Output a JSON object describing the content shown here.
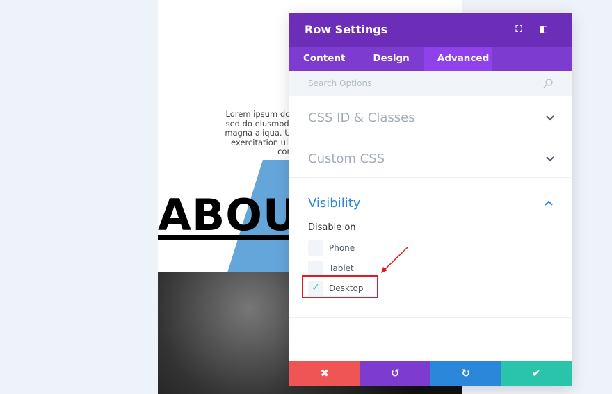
{
  "background_page": {
    "lorem_lines": [
      "Lorem ipsum dolor sit",
      "sed do eiusmod temp",
      "magna aliqua. Ut enin",
      "exercitation ullamc",
      "comm"
    ],
    "heading": "ABOU"
  },
  "panel": {
    "title": "Row Settings",
    "header_icons": [
      "fullscreen-icon",
      "sidebar-layout-icon"
    ],
    "tabs": [
      {
        "label": "Content"
      },
      {
        "label": "Design"
      },
      {
        "label": "Advanced",
        "active": true
      }
    ],
    "search_placeholder": "Search Options",
    "sections": [
      {
        "label": "CSS ID & Classes",
        "expanded": false
      },
      {
        "label": "Custom CSS",
        "expanded": false
      },
      {
        "label": "Visibility",
        "expanded": true
      }
    ],
    "visibility": {
      "label": "Disable on",
      "options": [
        {
          "label": "Phone",
          "checked": false
        },
        {
          "label": "Tablet",
          "checked": false
        },
        {
          "label": "Desktop",
          "checked": true
        }
      ]
    },
    "footer": {
      "colors": {
        "cancel": "#ef5555",
        "undo": "#7e3bd0",
        "redo": "#2b87da",
        "save": "#29c4a9"
      }
    }
  },
  "accent_colors": {
    "header": "#6c2eb9",
    "tabs": "#7e3bd0",
    "active_tab": "#8f42ec",
    "highlight": "#e8171d"
  }
}
